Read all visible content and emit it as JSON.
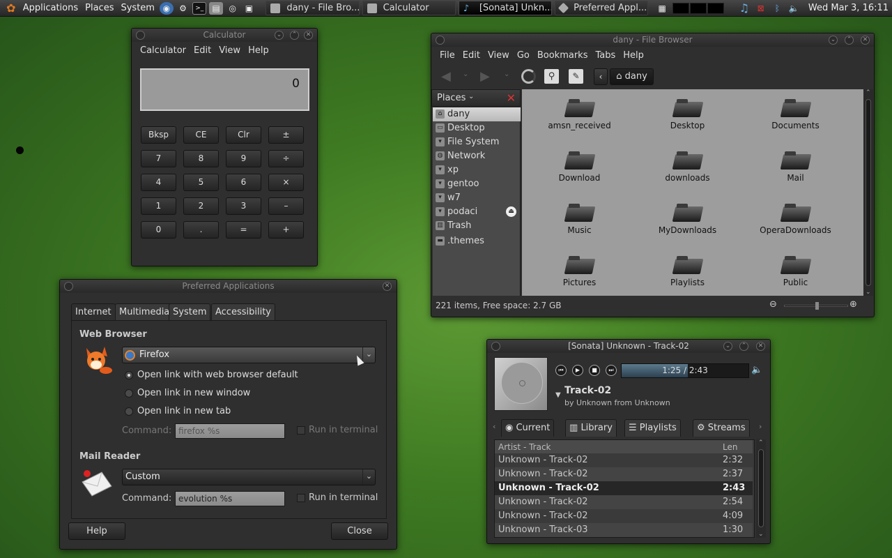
{
  "panel": {
    "menus": [
      "Applications",
      "Places",
      "System"
    ],
    "launchers": [
      "web-browser-icon",
      "settings-icon",
      "terminal-icon",
      "disk-icon",
      "music-icon",
      "screenshot-icon"
    ],
    "tasks": [
      {
        "label": "dany - File Bro...",
        "icon": "folder-icon",
        "active": false
      },
      {
        "label": "Calculator",
        "icon": "calculator-icon",
        "active": false
      },
      {
        "label": "[Sonata] Unkn...",
        "icon": "music-note-icon",
        "active": true
      },
      {
        "label": "Preferred Appl...",
        "icon": "preferences-icon",
        "active": false
      }
    ],
    "clock": "Wed Mar  3, 16:11"
  },
  "calculator": {
    "title": "Calculator",
    "menus": [
      "Calculator",
      "Edit",
      "View",
      "Help"
    ],
    "display": "0",
    "rows": [
      [
        "Bksp",
        "CE",
        "Clr",
        "±"
      ],
      [
        "7",
        "8",
        "9",
        "÷"
      ],
      [
        "4",
        "5",
        "6",
        "×"
      ],
      [
        "1",
        "2",
        "3",
        "–"
      ],
      [
        "0",
        ".",
        "=",
        "+"
      ]
    ]
  },
  "filebrowser": {
    "title": "dany - File Browser",
    "menus": [
      "File",
      "Edit",
      "View",
      "Go",
      "Bookmarks",
      "Tabs",
      "Help"
    ],
    "path": "dany",
    "places_label": "Places",
    "places": [
      {
        "label": "dany",
        "icon": "home-icon"
      },
      {
        "label": "Desktop",
        "icon": "desktop-icon"
      },
      {
        "label": "File System",
        "icon": "drive-icon"
      },
      {
        "label": "Network",
        "icon": "network-icon"
      },
      {
        "label": "xp",
        "icon": "drive-icon"
      },
      {
        "label": "gentoo",
        "icon": "drive-icon"
      },
      {
        "label": "w7",
        "icon": "drive-icon"
      },
      {
        "label": "podaci",
        "icon": "drive-icon"
      },
      {
        "label": "Trash",
        "icon": "trash-icon"
      },
      {
        "label": ".themes",
        "icon": "folder-icon"
      }
    ],
    "folders": [
      "amsn_received",
      "Desktop",
      "Documents",
      "Download",
      "downloads",
      "Mail",
      "Music",
      "MyDownloads",
      "OperaDownloads",
      "Pictures",
      "Playlists",
      "Public"
    ],
    "status": "221 items, Free space: 2.7 GB"
  },
  "prefapps": {
    "title": "Preferred Applications",
    "tabs": [
      "Internet",
      "Multimedia",
      "System",
      "Accessibility"
    ],
    "web_heading": "Web Browser",
    "browser": "Firefox",
    "open_options": [
      "Open link with web browser default",
      "Open link in new window",
      "Open link in new tab"
    ],
    "command_label": "Command:",
    "web_command": "firefox %s",
    "run_in_terminal": "Run in terminal",
    "mail_heading": "Mail Reader",
    "mail_client": "Custom",
    "mail_command": "evolution %s",
    "help": "Help",
    "close": "Close"
  },
  "sonata": {
    "title": "[Sonata] Unknown - Track-02",
    "time": "1:25 / 2:43",
    "progress": 0.52,
    "track": "Track-02",
    "artist_line": "by Unknown from Unknown",
    "tabs": [
      "Current",
      "Library",
      "Playlists",
      "Streams"
    ],
    "col_track": "Artist - Track",
    "col_len": "Len",
    "rows": [
      {
        "track": "Unknown - Track-02",
        "len": "2:32",
        "playing": false
      },
      {
        "track": "Unknown - Track-02",
        "len": "2:37",
        "playing": false
      },
      {
        "track": "Unknown - Track-02",
        "len": "2:43",
        "playing": true
      },
      {
        "track": "Unknown - Track-02",
        "len": "2:54",
        "playing": false
      },
      {
        "track": "Unknown - Track-02",
        "len": "4:09",
        "playing": false
      },
      {
        "track": "Unknown - Track-03",
        "len": "1:30",
        "playing": false
      }
    ]
  }
}
